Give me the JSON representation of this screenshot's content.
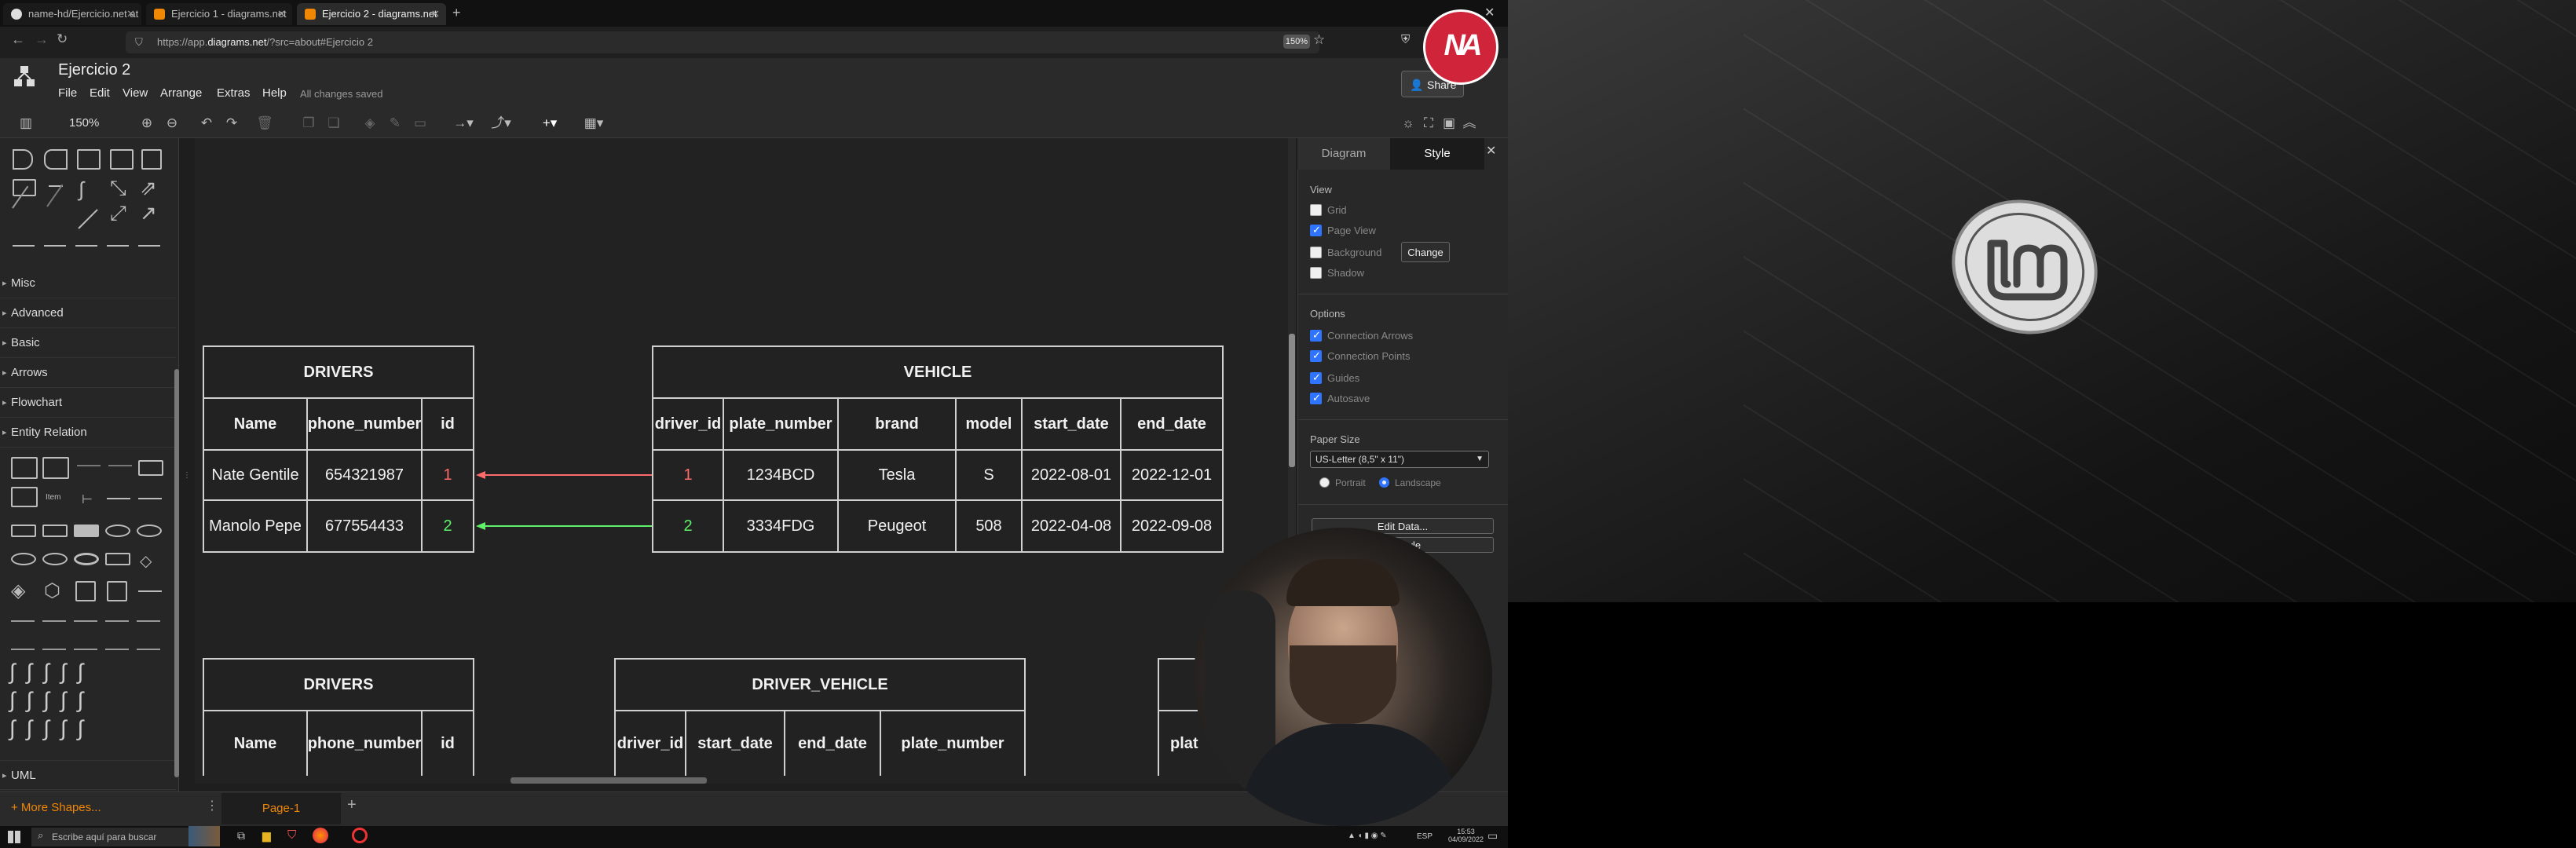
{
  "browser": {
    "tabs": [
      {
        "label": "name-hd/Ejercicio.net at mai"
      },
      {
        "label": "Ejercicio 1 - diagrams.net"
      },
      {
        "label": "Ejercicio 2 - diagrams.net"
      }
    ],
    "url_prefix": "https://app.",
    "url_domain": "diagrams.net",
    "url_rest": "/?src=about#Ejercicio 2",
    "zoom_badge": "150%"
  },
  "app": {
    "title": "Ejercicio 2",
    "menu": [
      "File",
      "Edit",
      "View",
      "Arrange",
      "Extras",
      "Help"
    ],
    "save_status": "All changes saved",
    "share_label": "Share",
    "zoom": "150%"
  },
  "sidebar": {
    "sections": [
      "Misc",
      "Advanced",
      "Basic",
      "Arrows",
      "Flowchart",
      "Entity Relation",
      "UML"
    ],
    "more_shapes": "+ More Shapes..."
  },
  "diagram": {
    "drivers1": {
      "title": "DRIVERS",
      "headers": [
        "Name",
        "phone_number",
        "id"
      ],
      "rows": [
        [
          "Nate Gentile",
          "654321987",
          "1"
        ],
        [
          "Manolo Pepe",
          "677554433",
          "2"
        ]
      ]
    },
    "vehicle": {
      "title": "VEHICLE",
      "headers": [
        "driver_id",
        "plate_number",
        "brand",
        "model",
        "start_date",
        "end_date"
      ],
      "rows": [
        [
          "1",
          "1234BCD",
          "Tesla",
          "S",
          "2022-08-01",
          "2022-12-01"
        ],
        [
          "2",
          "3334FDG",
          "Peugeot",
          "508",
          "2022-04-08",
          "2022-09-08"
        ]
      ]
    },
    "drivers2": {
      "title": "DRIVERS",
      "headers": [
        "Name",
        "phone_number",
        "id"
      ]
    },
    "driver_vehicle": {
      "title": "DRIVER_VEHICLE",
      "headers": [
        "driver_id",
        "start_date",
        "end_date",
        "plate_number"
      ]
    },
    "partial_header": "plat",
    "arrow_colors": {
      "red": "#ff6b6b",
      "green": "#5ff16a"
    }
  },
  "format_panel": {
    "tabs": [
      "Diagram",
      "Style"
    ],
    "view_title": "View",
    "view_options": [
      {
        "label": "Grid",
        "checked": false
      },
      {
        "label": "Page View",
        "checked": true
      },
      {
        "label": "Background",
        "checked": false
      },
      {
        "label": "Shadow",
        "checked": false
      }
    ],
    "change_label": "Change",
    "options_title": "Options",
    "options": [
      {
        "label": "Connection Arrows",
        "checked": true
      },
      {
        "label": "Connection Points",
        "checked": true
      },
      {
        "label": "Guides",
        "checked": true
      },
      {
        "label": "Autosave",
        "checked": true
      }
    ],
    "paper_title": "Paper Size",
    "paper_value": "US-Letter (8,5\" x 11\")",
    "portrait": "Portrait",
    "landscape": "Landscape",
    "edit_data": "Edit Data...",
    "default_style": "ult Style"
  },
  "pages": {
    "active": "Page-1"
  },
  "taskbar": {
    "search_placeholder": "Escribe aquí para buscar",
    "lang": "ESP",
    "time": "15:53",
    "date": "04/09/2022"
  },
  "overlay": {
    "logo": "NA"
  }
}
